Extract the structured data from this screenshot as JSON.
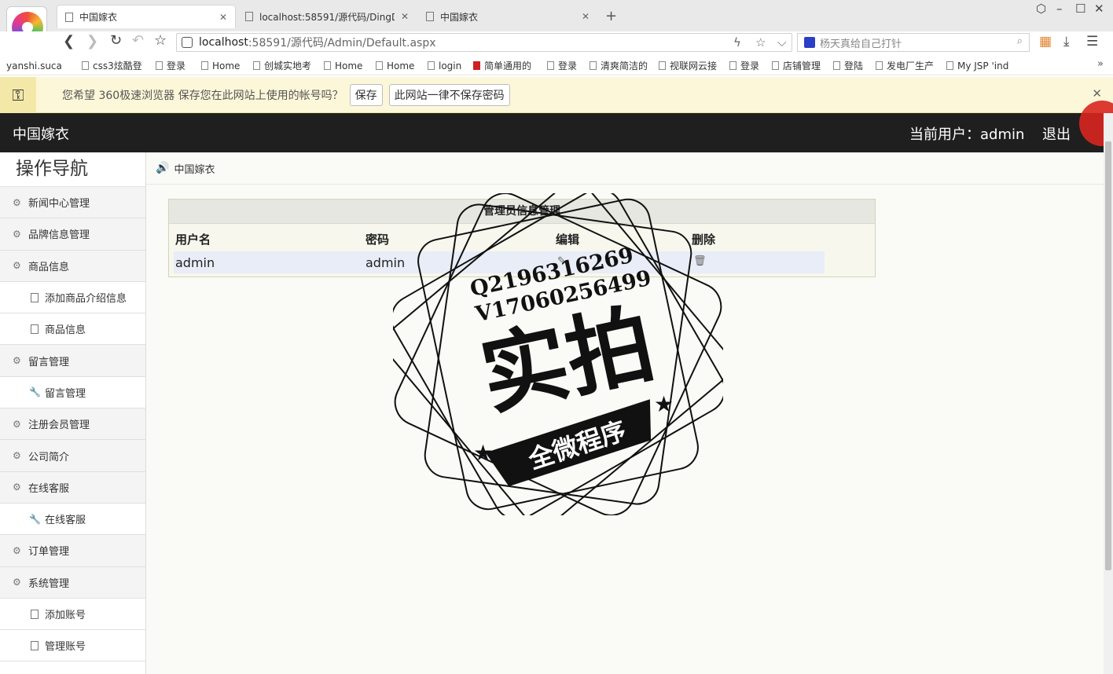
{
  "browser": {
    "tabs": [
      {
        "label": "中国嫁衣",
        "active": true
      },
      {
        "label": "localhost:58591/源代码/DingD",
        "active": false
      },
      {
        "label": "中国嫁衣",
        "active": false
      }
    ],
    "address": {
      "host": "localhost",
      "path": ":58591/源代码/Admin/Default.aspx"
    },
    "search_text": "杨天真给自己打针",
    "bookmarks": [
      {
        "label": "yanshi.suca"
      },
      {
        "label": "css3炫酷登"
      },
      {
        "label": "登录"
      },
      {
        "label": "Home"
      },
      {
        "label": "创城实地考"
      },
      {
        "label": "Home"
      },
      {
        "label": "Home"
      },
      {
        "label": "login"
      },
      {
        "label": "简单通用的"
      },
      {
        "label": "登录"
      },
      {
        "label": "清爽简洁的"
      },
      {
        "label": "视联网云接"
      },
      {
        "label": "登录"
      },
      {
        "label": "店铺管理"
      },
      {
        "label": "登陆"
      },
      {
        "label": "发电厂生产"
      },
      {
        "label": "My JSP 'ind"
      }
    ],
    "password_bar": {
      "message": "您希望 360极速浏览器 保存您在此网站上使用的帐号吗？",
      "save_label": "保存",
      "never_label": "此网站一律不保存密码"
    }
  },
  "header": {
    "brand": "中国嫁衣",
    "current_user": "当前用户：admin",
    "logout": "退出"
  },
  "sidebar": {
    "title": "操作导航",
    "items": [
      {
        "label": "新闻中心管理",
        "kind": "top"
      },
      {
        "label": "品牌信息管理",
        "kind": "top"
      },
      {
        "label": "商品信息",
        "kind": "top"
      },
      {
        "label": "添加商品介绍信息",
        "kind": "doc"
      },
      {
        "label": "商品信息",
        "kind": "doc"
      },
      {
        "label": "留言管理",
        "kind": "top"
      },
      {
        "label": "留言管理",
        "kind": "wrench"
      },
      {
        "label": "注册会员管理",
        "kind": "top"
      },
      {
        "label": "公司简介",
        "kind": "top"
      },
      {
        "label": "在线客服",
        "kind": "top"
      },
      {
        "label": "在线客服",
        "kind": "wrench"
      },
      {
        "label": "订单管理",
        "kind": "top"
      },
      {
        "label": "系统管理",
        "kind": "top"
      },
      {
        "label": "添加账号",
        "kind": "doc"
      },
      {
        "label": "管理账号",
        "kind": "doc"
      }
    ]
  },
  "breadcrumb": "中国嫁衣",
  "admin_table": {
    "caption": "管理员信息管理",
    "columns": [
      "用户名",
      "密码",
      "编辑",
      "删除"
    ],
    "rows": [
      {
        "username": "admin",
        "password": "admin"
      }
    ]
  },
  "watermark": {
    "line1": "Q2196316269",
    "line2": "V17060256499",
    "big": "实拍",
    "banner": "全微程序"
  }
}
